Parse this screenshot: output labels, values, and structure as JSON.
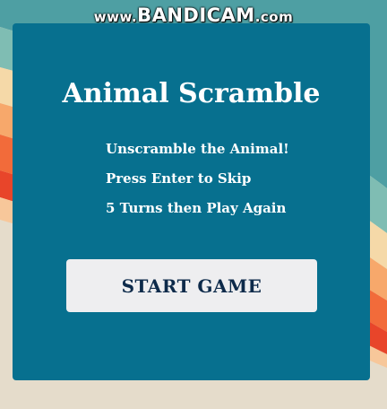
{
  "watermark": {
    "prefix": "www.",
    "brand": "BANDICAM",
    "suffix": ".com"
  },
  "game": {
    "title": "Animal Scramble",
    "instructions": [
      "Unscramble the Animal!",
      "Press Enter to Skip",
      "5 Turns then Play Again"
    ],
    "start_label": "START GAME"
  },
  "colors": {
    "card_background": "#07708f",
    "button_background": "#eeeef0",
    "button_text": "#0d2a4a",
    "stripe_teal": "#5fa8a8",
    "stripe_orange": "#f26b3a",
    "stripe_red": "#e8452a",
    "stripe_peach": "#f7a86b",
    "stripe_cream": "#f5d9a8",
    "ground": "#e5dccb"
  }
}
